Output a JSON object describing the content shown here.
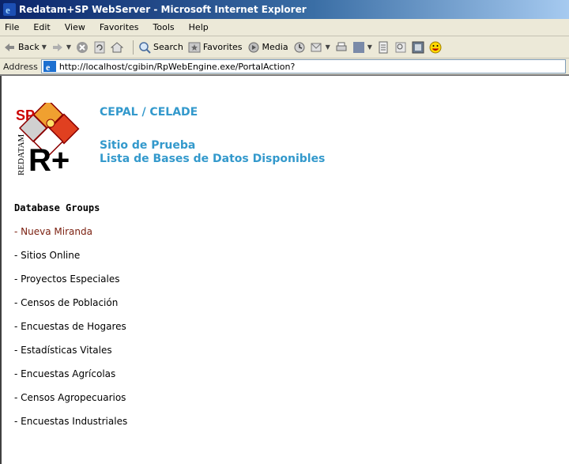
{
  "window": {
    "title": "Redatam+SP WebServer - Microsoft Internet Explorer"
  },
  "menu": {
    "items": [
      "File",
      "Edit",
      "View",
      "Favorites",
      "Tools",
      "Help"
    ]
  },
  "toolbar": {
    "back_label": "Back",
    "search_label": "Search",
    "favorites_label": "Favorites",
    "media_label": "Media"
  },
  "address": {
    "label": "Address",
    "url": "http://localhost/cgibin/RpWebEngine.exe/PortalAction?"
  },
  "page": {
    "org": "CEPAL / CELADE",
    "site": "Sitio de Prueba",
    "list_title": "Lista de Bases de Datos Disponibles",
    "groups_heading": "Database Groups",
    "groups": [
      "- Nueva Miranda",
      "- Sitios Online",
      "- Proyectos Especiales",
      "- Censos de Población",
      "- Encuestas de Hogares",
      "- Estadísticas Vitales",
      "- Encuestas Agrícolas",
      "- Censos Agropecuarios",
      "- Encuestas Industriales"
    ],
    "logo_text_vertical": "REDATAM",
    "logo_text_sp": "SP",
    "logo_text_r": "R+"
  },
  "colors": {
    "header_blue": "#3399cc",
    "first_link": "#7a1e0e",
    "titlebar_start": "#0a246a",
    "titlebar_end": "#a6caf0"
  }
}
